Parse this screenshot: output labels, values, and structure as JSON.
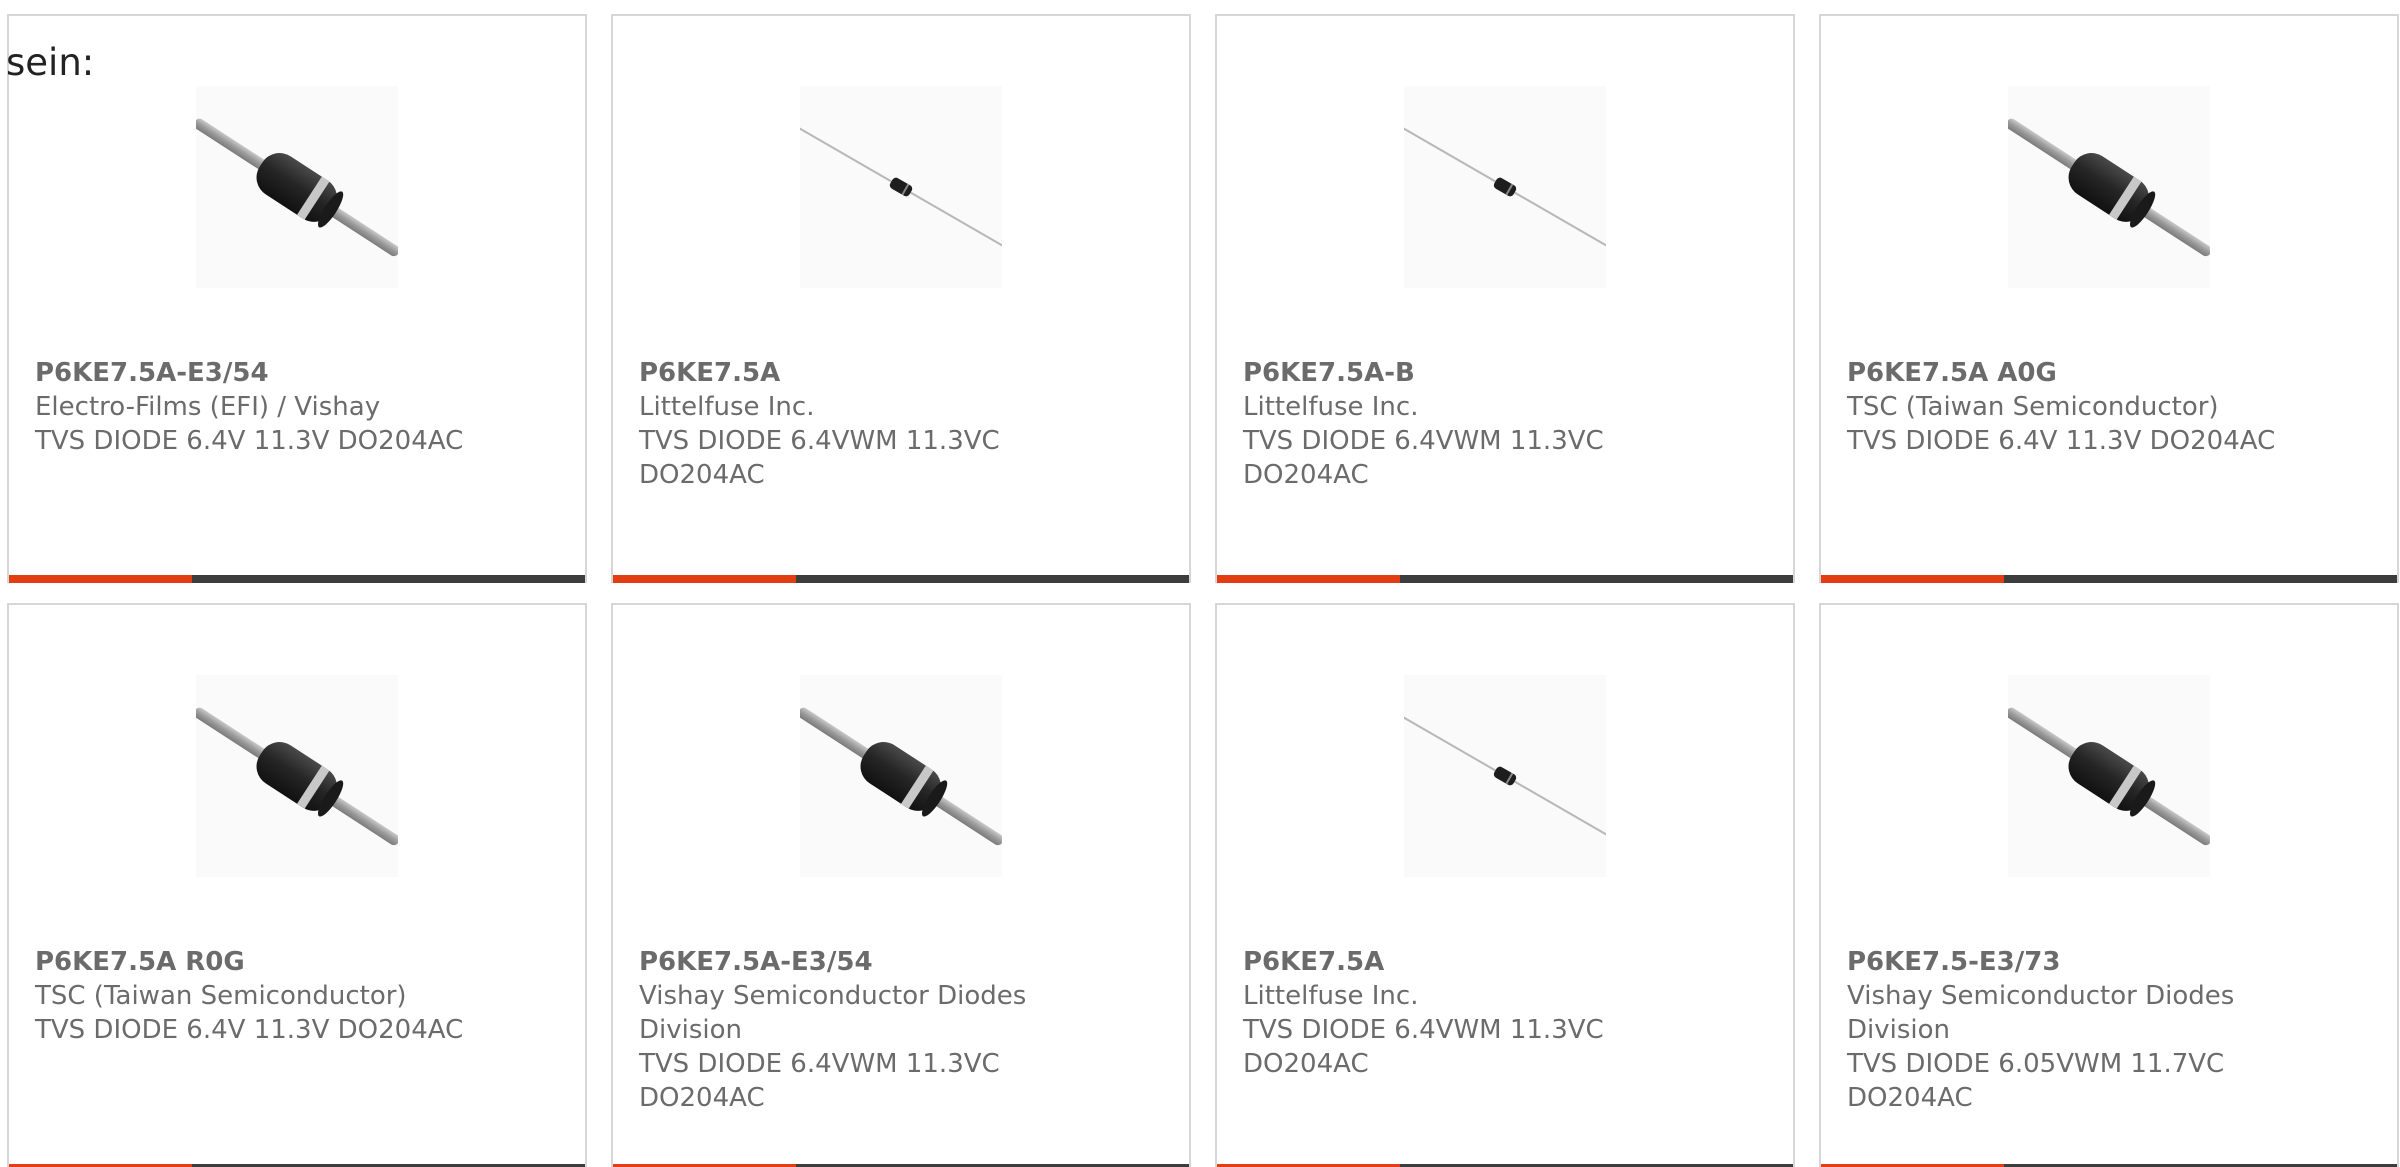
{
  "intro_text": "sein:",
  "colors": {
    "accent": "#e23d13",
    "bar": "#3d3d3d",
    "border": "#d6d6d6",
    "text": "#6b6b6b"
  },
  "products": [
    {
      "part_number": "P6KE7.5A-E3/54",
      "manufacturer": "Electro-Films (EFI) / Vishay",
      "description": "TVS DIODE 6.4V 11.3V DO204AC",
      "image": "diode-large-image"
    },
    {
      "part_number": "P6KE7.5A",
      "manufacturer": "Littelfuse Inc.",
      "description": "TVS DIODE 6.4VWM 11.3VC DO204AC",
      "image": "diode-small-image"
    },
    {
      "part_number": "P6KE7.5A-B",
      "manufacturer": "Littelfuse Inc.",
      "description": "TVS DIODE 6.4VWM 11.3VC DO204AC",
      "image": "diode-small-image"
    },
    {
      "part_number": "P6KE7.5A A0G",
      "manufacturer": "TSC (Taiwan Semiconductor)",
      "description": "TVS DIODE 6.4V 11.3V DO204AC",
      "image": "diode-large-image"
    },
    {
      "part_number": "P6KE7.5A R0G",
      "manufacturer": "TSC (Taiwan Semiconductor)",
      "description": "TVS DIODE 6.4V 11.3V DO204AC",
      "image": "diode-large-image"
    },
    {
      "part_number": "P6KE7.5A-E3/54",
      "manufacturer": "Vishay Semiconductor Diodes Division",
      "description": "TVS DIODE 6.4VWM 11.3VC DO204AC",
      "image": "diode-large-image"
    },
    {
      "part_number": "P6KE7.5A",
      "manufacturer": "Littelfuse Inc.",
      "description": "TVS DIODE 6.4VWM 11.3VC DO204AC",
      "image": "diode-small-image"
    },
    {
      "part_number": "P6KE7.5-E3/73",
      "manufacturer": "Vishay Semiconductor Diodes Division",
      "description": "TVS DIODE 6.05VWM 11.7VC DO204AC",
      "image": "diode-large-image"
    }
  ]
}
